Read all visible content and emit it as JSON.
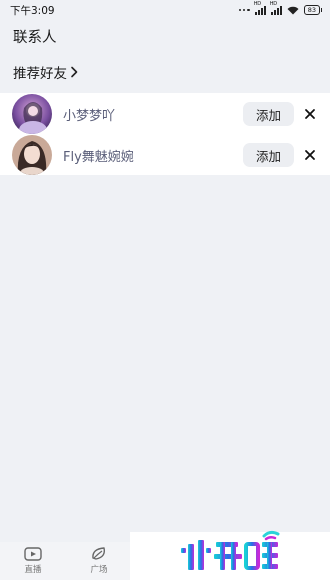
{
  "status_bar": {
    "time": "下午3:09",
    "net_label_1": "HD",
    "net_label_2": "HD",
    "battery": "83"
  },
  "page_title": "联系人",
  "recommend": {
    "label": "推荐好友"
  },
  "contacts": [
    {
      "name": "小梦梦吖",
      "add_label": "添加"
    },
    {
      "name": "Fly舞魅婉婉",
      "add_label": "添加"
    }
  ],
  "bottom_nav": {
    "items": [
      {
        "label": "直播",
        "icon": "live-video-icon"
      },
      {
        "label": "广场",
        "icon": "square-leaf-icon"
      }
    ]
  },
  "watermark": {
    "text": "兆升旺"
  },
  "colors": {
    "page_bg": "#eff1f5",
    "contact_name": "#5a5e79",
    "button_bg": "#eceef2"
  }
}
